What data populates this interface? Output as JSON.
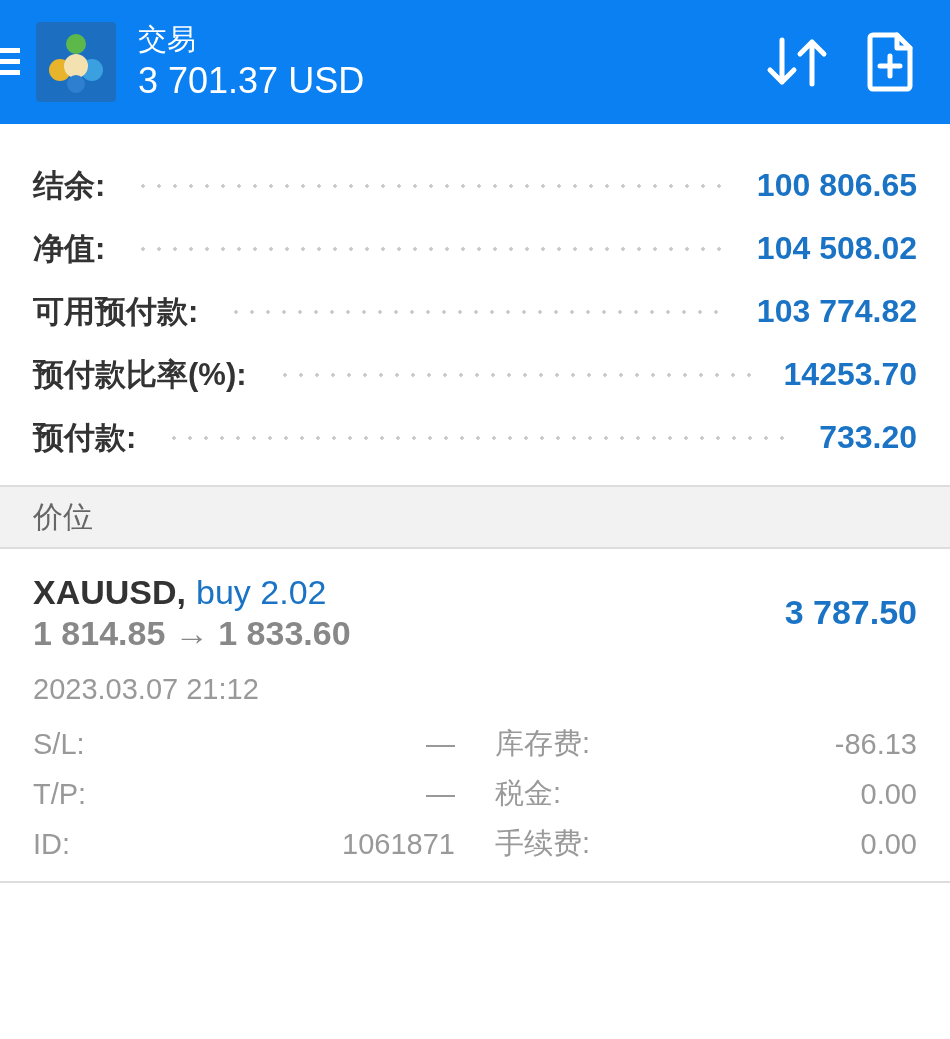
{
  "header": {
    "title": "交易",
    "balance": "3 701.37 USD"
  },
  "summary": [
    {
      "label": "结余:",
      "value": "100 806.65"
    },
    {
      "label": "净值:",
      "value": "104 508.02"
    },
    {
      "label": "可用预付款:",
      "value": "103 774.82"
    },
    {
      "label": "预付款比率(%):",
      "value": "14253.70"
    },
    {
      "label": "预付款:",
      "value": "733.20"
    }
  ],
  "section": {
    "title": "价位"
  },
  "positions": [
    {
      "symbol": "XAUUSD,",
      "side": "buy 2.02",
      "prices": "1 814.85 → 1 833.60",
      "profit": "3 787.50",
      "time": "2023.03.07 21:12",
      "details": [
        {
          "label": "S/L:",
          "value": "—"
        },
        {
          "label": "库存费:",
          "value": "-86.13"
        },
        {
          "label": "T/P:",
          "value": "—"
        },
        {
          "label": "税金:",
          "value": "0.00"
        },
        {
          "label": "ID:",
          "value": "1061871"
        },
        {
          "label": "手续费:",
          "value": "0.00"
        }
      ]
    }
  ]
}
